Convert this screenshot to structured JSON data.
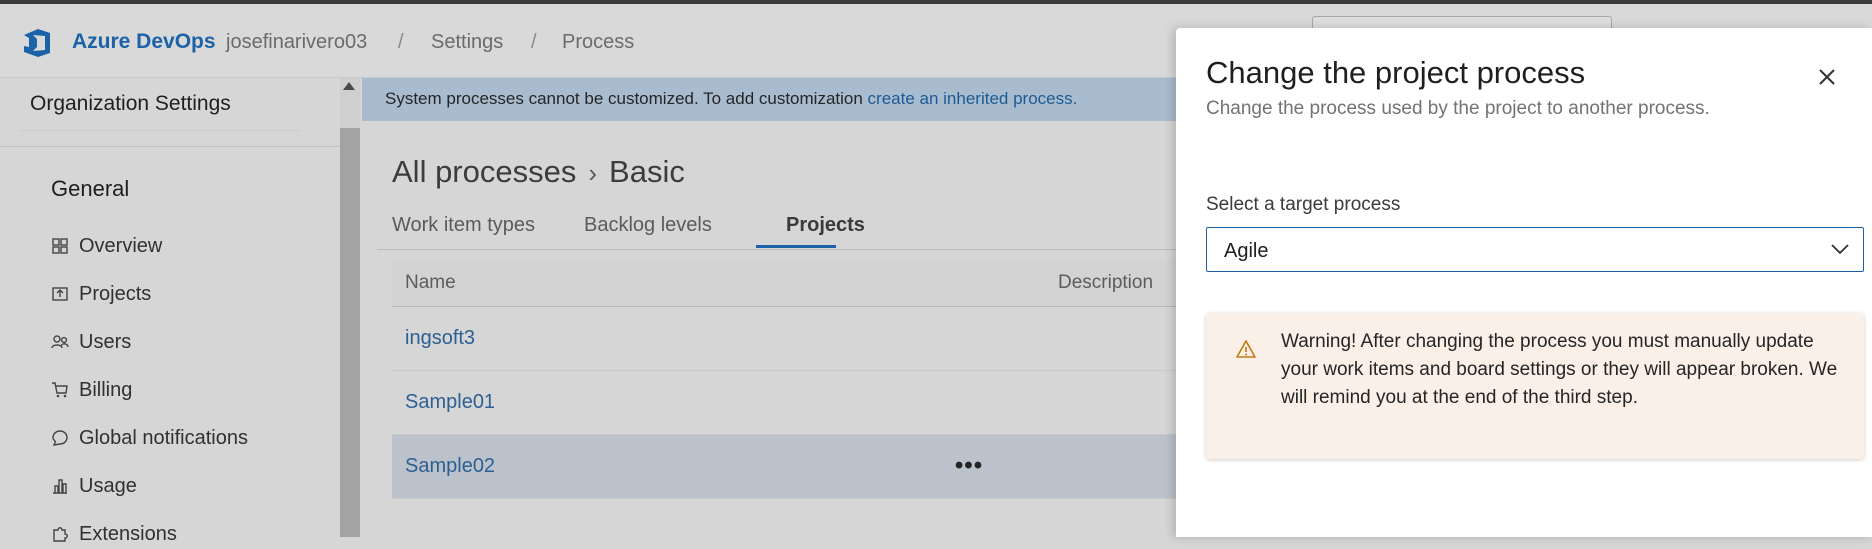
{
  "header": {
    "brand": "Azure DevOps",
    "breadcrumbs": [
      "josefinarivero03",
      "Settings",
      "Process"
    ],
    "separator": "/"
  },
  "sidebar": {
    "title": "Organization Settings",
    "group": "General",
    "items": [
      {
        "label": "Overview",
        "icon": "overview-icon"
      },
      {
        "label": "Projects",
        "icon": "projects-icon"
      },
      {
        "label": "Users",
        "icon": "users-icon"
      },
      {
        "label": "Billing",
        "icon": "cart-icon"
      },
      {
        "label": "Global notifications",
        "icon": "chat-icon"
      },
      {
        "label": "Usage",
        "icon": "usage-icon"
      },
      {
        "label": "Extensions",
        "icon": "puzzle-icon"
      }
    ]
  },
  "main": {
    "banner_text": "System processes cannot be customized. To add customization ",
    "banner_link": "create an inherited process.",
    "title_root": "All processes",
    "title_leaf": "Basic",
    "tabs": [
      "Work item types",
      "Backlog levels",
      "Projects"
    ],
    "active_tab": "Projects",
    "columns": [
      "Name",
      "Description"
    ],
    "rows": [
      "ingsoft3",
      "Sample01",
      "Sample02"
    ],
    "more_label": "•••"
  },
  "panel": {
    "title": "Change the project process",
    "subtitle": "Change the process used by the project to another process.",
    "field_label": "Select a target process",
    "selected_process": "Agile",
    "warning": "Warning! After changing the process you must manually update your work items and board settings or they will appear broken. We will remind you at the end of the third step."
  },
  "colors": {
    "accent": "#1b62a8",
    "link": "#2c5f93",
    "banner": "#a9bccf",
    "warning_bg": "#fbf0e8",
    "warning_icon": "#c27a12"
  }
}
